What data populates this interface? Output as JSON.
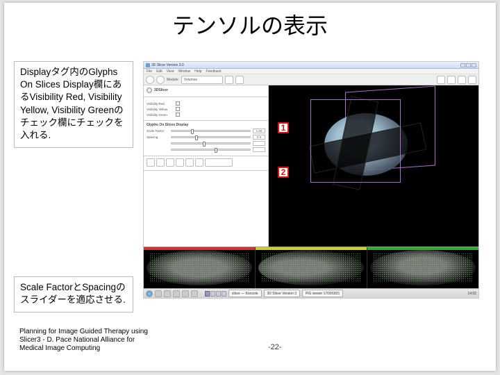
{
  "title": "テンソルの表示",
  "note1": "Displayタグ内のGlyphs On Slices Display欄にあるVisibility Red, Visibility Yellow, Visibility Greenのチェック欄にチェックを入れる.",
  "note2": "Scale FactorとSpacingのスライダーを適応させる.",
  "credit": "Planning for Image Guided Therapy using Slicer3 - D. Pace National Alliance for Medical Image Computing",
  "page_number": "-22-",
  "callouts": {
    "c1": "1",
    "c2": "2"
  },
  "shot": {
    "titlebar": "3D Slicer Version 3.0",
    "menu": [
      "File",
      "Edit",
      "View",
      "Window",
      "Help",
      "Feedback"
    ],
    "toolbar": {
      "module_label": "Module:",
      "module_value": "Volumes"
    },
    "left_panel": {
      "header_label": "3DSlicer",
      "sec1": {
        "rows": [
          {
            "label": "Visibility Red",
            "checked": true
          },
          {
            "label": "Visibility Yellow",
            "checked": true
          },
          {
            "label": "Visibility Green",
            "checked": true
          }
        ]
      },
      "sec2_title": "Glyphs On Slices Display",
      "sliders": [
        {
          "label": "Scale Factor",
          "value_text": "1.00",
          "pos_pct": 25
        },
        {
          "label": "Spacing",
          "value_text": "2.0",
          "pos_pct": 30
        }
      ]
    },
    "taskbar": {
      "apps": [
        "slicer — Konsole",
        "3D Slicer Version 3",
        "PlG viewer  1709/1831"
      ],
      "clock": "14:02"
    }
  }
}
